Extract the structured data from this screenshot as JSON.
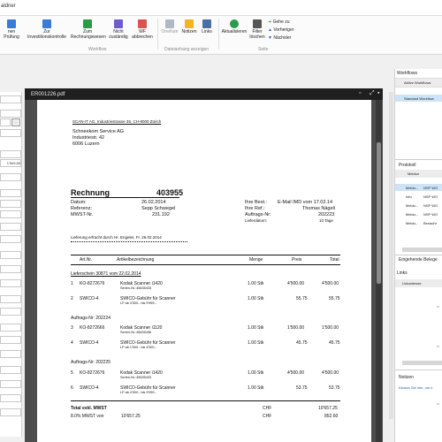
{
  "app": {
    "title_fragment": "aldner"
  },
  "ribbon": {
    "buttons": [
      {
        "id": "pruefung",
        "label": "nen Prüfung",
        "color": "#3a7bd5"
      },
      {
        "id": "investition",
        "label": "Zur Investitionskontrolle",
        "color": "#3a7bd5"
      },
      {
        "id": "rechnungswesen",
        "label": "Zum Rechnungswesen",
        "color": "#2b9a4a"
      },
      {
        "id": "nicht-zustaendig",
        "label": "Nicht zuständig",
        "color": "#6f5bd0"
      },
      {
        "id": "wf-abbrechen",
        "label": "WF abbrechen",
        "color": "#d9534f"
      },
      {
        "id": "onefiute",
        "label": "Onefiute",
        "color": "#b0b8c8"
      },
      {
        "id": "notizen",
        "label": "Notizen",
        "color": "#f0b429"
      },
      {
        "id": "links",
        "label": "Links",
        "color": "#4a6fa5"
      },
      {
        "id": "aktualisieren",
        "label": "Aktualisieren",
        "color": "#2b9a4a"
      },
      {
        "id": "filter-loeschen",
        "label": "Filter löschen",
        "color": "#555555"
      }
    ],
    "goto": [
      "Gehe zu",
      "Vorheriger",
      "Nächster"
    ],
    "groups": {
      "workflow": "Workflow",
      "dateianhang": "Dateianhang anzeigen",
      "seite": "Seite"
    }
  },
  "left_fields": [
    "",
    "",
    "",
    "",
    "",
    "1'509.85",
    "",
    "",
    "",
    "",
    "",
    "",
    "",
    "",
    "",
    "",
    "",
    "",
    "",
    "",
    "",
    "",
    "",
    ""
  ],
  "pdf": {
    "filename": "ER001226.pdf",
    "sender_line": "SCAN-IT AG, Industriestrasse 35, CH-8000 Zürich",
    "address": [
      "Schneekom Service AG",
      "Industriestr. 42",
      "6006 Luzern"
    ],
    "heading": "Rechnung",
    "number": "403955",
    "meta_left": [
      [
        "Datum:",
        "26.02.2014"
      ],
      [
        "Referenz:",
        "Sepp Schwegel"
      ],
      [
        "MWST-Nr.",
        "231.192"
      ]
    ],
    "meta_right": [
      [
        "Ihre Best.:",
        "E-Mail IMD vom 17.02.14"
      ],
      [
        "Ihre Ref.:",
        "Thomas Nägeli"
      ],
      [
        "Auftrags-Nr:",
        "202223"
      ],
      [
        "Lieferdatum:",
        "10 Tage"
      ]
    ],
    "delivery_note": "Lieferung erfracht durch Hr. Engeler, Fr. 26.02.2014",
    "columns": [
      "Art.Nr.",
      "Artikelbezeichnung",
      "Menge",
      "Preis",
      "Total"
    ],
    "lieferschein": "Lieferschein 30871   vom  22.02.2014",
    "items": [
      {
        "n": "1",
        "art": "KO-8272676",
        "desc": "Kodak Scanner i1420",
        "sub": "Serien-Nr.:45635433",
        "qty": "1.00 Stk",
        "price": "4'500.00",
        "total": "4'500.00"
      },
      {
        "n": "2",
        "art": "SWICO-4",
        "desc": "SWICO-Gebühr für Scanner",
        "sub": "LP ab 4'500.- bis 9'999.-",
        "qty": "1.00 Stk",
        "price": "55.75",
        "total": "55.75"
      },
      {
        "n": "3",
        "art": "KO-8272666",
        "desc": "Kodak Scanner i1120",
        "sub": "Serien-Nr.:45635436",
        "qty": "1.00 Stk",
        "price": "1'500.00",
        "total": "1'500.00"
      },
      {
        "n": "4",
        "art": "SWICO-4",
        "desc": "SWICO-Gebühr für Scanner",
        "sub": "LP ab 1'500.- bis 4'500.-",
        "qty": "1.00 Stk",
        "price": "45.75",
        "total": "45.75"
      },
      {
        "n": "5",
        "art": "KO-8272676",
        "desc": "Kodak Scanner i1420",
        "sub": "Serien-Nr.:45635433",
        "qty": "1.00 Stk",
        "price": "4'500.00",
        "total": "4'500.00"
      },
      {
        "n": "6",
        "art": "SWICO-4",
        "desc": "SWICO-Gebühr für Scanner",
        "sub": "LP ab 4'500.- bis 9'999.-",
        "qty": "1.00 Stk",
        "price": "53.75",
        "total": "53.75"
      }
    ],
    "auftrag1": "Auftrags-Nr:        202224",
    "auftrag2": "Auftrags-Nr:        202225",
    "total_label": "Total exkl. MWST",
    "total_cur": "CHF",
    "total_value": "10'657.25",
    "mwst_label": "8.0%   MWST von",
    "mwst_base": "10'657.25",
    "mwst_cur": "CHF",
    "mwst_value": "852.60"
  },
  "right": {
    "workflows_title": "Workflows",
    "aktive": "Aktive Workflows",
    "standard": "Standard Workflow",
    "protokoll_title": "Protokoll",
    "protokoll_header": "Meldun",
    "protokoll_rows": [
      [
        "Meldu...",
        "NSP WO"
      ],
      [
        "Info",
        "NSP WO"
      ],
      [
        "Meldu...",
        "NSP WO"
      ],
      [
        "Meldu...",
        "NSP WO"
      ],
      [
        "Meldu...",
        "Benachr"
      ]
    ],
    "eingehende": "Eingehende Belege",
    "links_title": "Links",
    "linkadresse": "Linkadresse",
    "ln1": "In",
    "ln2": "In",
    "notizen_title": "Notizen",
    "notizen_link": "Klicken Sie hier, um e",
    "notizen_in": "In"
  }
}
